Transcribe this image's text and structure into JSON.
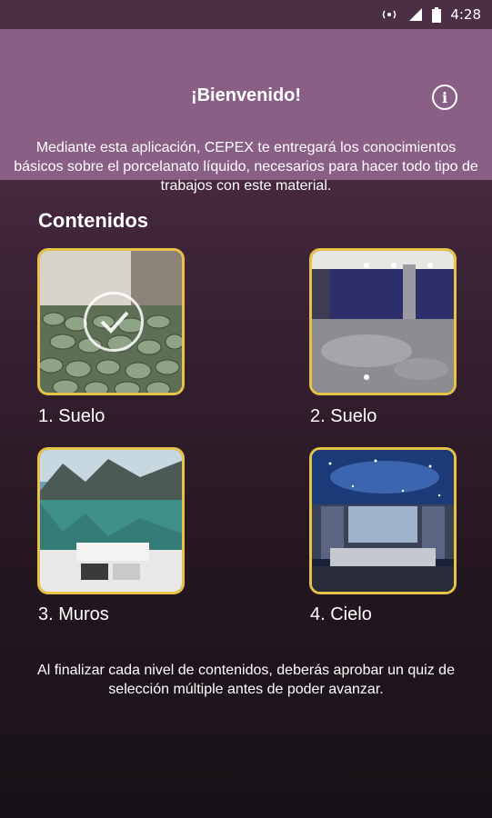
{
  "status_bar": {
    "time": "4:28"
  },
  "header": {
    "title": "¡Bienvenido!",
    "info_icon_label": "i",
    "description": "Mediante esta aplicación, CEPEX te entregará los conocimientos básicos sobre el porcelanato líquido, necesarios para hacer todo tipo de trabajos con este material."
  },
  "contents": {
    "title": "Contenidos",
    "items": [
      {
        "label": "1. Suelo",
        "completed": true
      },
      {
        "label": "2. Suelo",
        "completed": false
      },
      {
        "label": "3. Muros",
        "completed": false
      },
      {
        "label": "4. Cielo",
        "completed": false
      }
    ]
  },
  "footer": {
    "note": "Al finalizar cada nivel de contenidos, deberás aprobar un quiz de selección múltiple antes de poder avanzar."
  },
  "colors": {
    "accent_border": "#e6c347",
    "header_bg": "#8a5f86"
  }
}
